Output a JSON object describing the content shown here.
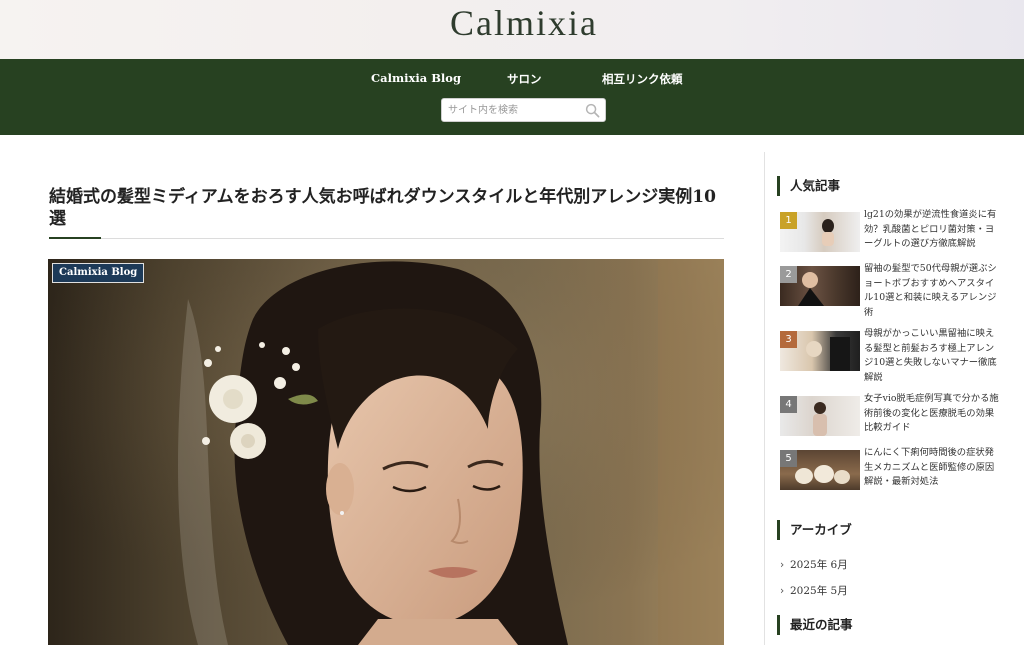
{
  "site": {
    "logo": "Calmixia"
  },
  "nav": {
    "items": [
      {
        "label": "Calmixia Blog"
      },
      {
        "label": "サロン"
      },
      {
        "label": "相互リンク依頼"
      }
    ],
    "search_placeholder": "サイト内を検索"
  },
  "article": {
    "title": "結婚式の髪型ミディアムをおろす人気お呼ばれダウンスタイルと年代別アレンジ実例10選",
    "category": "Calmixia Blog"
  },
  "sidebar": {
    "popular_title": "人気記事",
    "popular": [
      {
        "rank": "1",
        "rank_color": "#c9a227",
        "title": "lg21の効果が逆流性食道炎に有効？乳酸菌とピロリ菌対策・ヨーグルトの選び方徹底解説"
      },
      {
        "rank": "2",
        "rank_color": "#9a9a9a",
        "title": "留袖の髪型で50代母親が選ぶショートボブおすすめヘアスタイル10選と和装に映えるアレンジ術"
      },
      {
        "rank": "3",
        "rank_color": "#b46a3c",
        "title": "母親がかっこいい黒留袖に映える髪型と前髪おろす極上アレンジ10選と失敗しないマナー徹底解説"
      },
      {
        "rank": "4",
        "rank_color": "#777777",
        "title": "女子vio脱毛症例写真で分かる施術前後の変化と医療脱毛の効果比較ガイド"
      },
      {
        "rank": "5",
        "rank_color": "#777777",
        "title": "にんにく下痢何時間後の症状発生メカニズムと医師監修の原因解説・最新対処法"
      }
    ],
    "archive_title": "アーカイブ",
    "archives": [
      {
        "label": "2025年 6月"
      },
      {
        "label": "2025年 5月"
      }
    ],
    "recent_title": "最近の記事"
  },
  "colors": {
    "nav_bg": "#274121",
    "accent": "#274121",
    "badge_bg": "#1d3a58"
  }
}
